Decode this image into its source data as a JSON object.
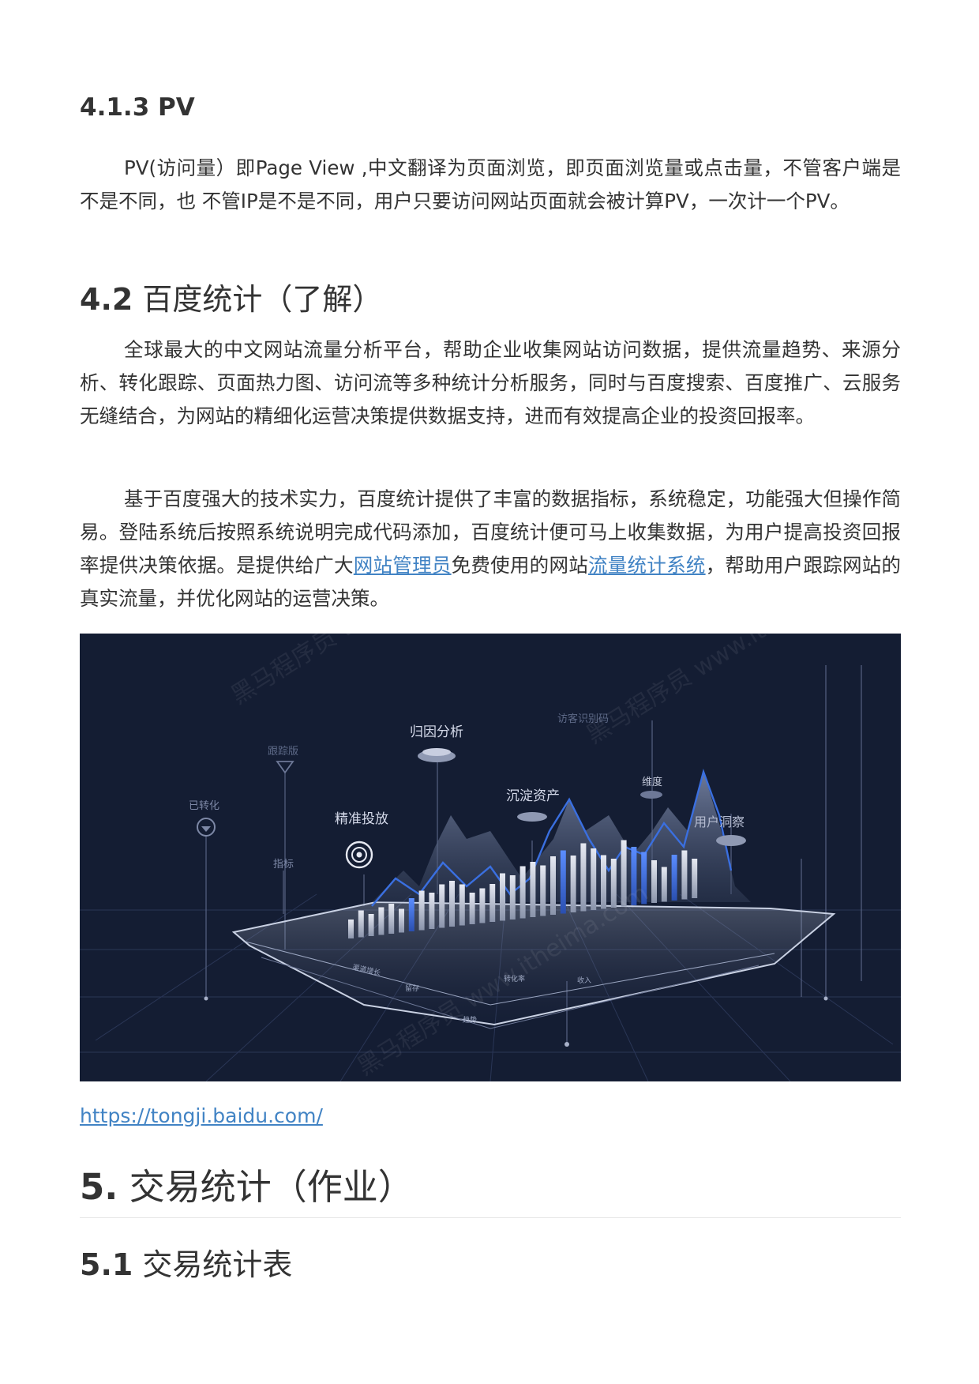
{
  "section_413": {
    "title": "4.1.3 PV"
  },
  "pv_paragraph": {
    "text": "PV(访问量）即Page View ,中文翻译为页面浏览，即页面浏览量或点击量，不管客户端是不是不同，也 不管IP是不是不同，用户只要访问网站页面就会被计算PV，一次计一个PV。"
  },
  "section_42": {
    "number": "4.2",
    "title": "百度统计（了解）"
  },
  "baidu_para1": {
    "text": "全球最大的中文网站流量分析平台，帮助企业收集网站访问数据，提供流量趋势、来源分析、转化跟踪、页面热力图、访问流等多种统计分析服务，同时与百度搜索、百度推广、云服务无缝结合，为网站的精细化运营决策提供数据支持，进而有效提高企业的投资回报率。"
  },
  "baidu_para2": {
    "part1": "基于百度强大的技术实力，百度统计提供了丰富的数据指标，系统稳定，功能强大但操作简易。登陆系统后按照系统说明完成代码添加，百度统计便可马上收集数据，为用户提高投资回报率提供决策依据。是提供给广大",
    "link1": "网站管理员",
    "part2": "免费使用的网站",
    "link2": "流量统计系统",
    "part3": "，帮助用户跟踪网站的真实流量，并优化网站的运营决策。"
  },
  "hero_image": {
    "labels": {
      "attribution": "归因分析",
      "visitor": "访客识别码",
      "tracking": "跟踪版",
      "precise": "精准投放",
      "assets": "沉淀资产",
      "dimension": "维度",
      "converted": "已转化",
      "insight": "用户洞察",
      "metric": "指标",
      "growth": "渠道增长",
      "retain": "留存",
      "trend": "趋势",
      "income": "收入",
      "rate": "转化率"
    },
    "watermark": "黑马程序员 www.itheima.com",
    "colors": {
      "background": "#141d33",
      "accent": "#3a6fe0"
    }
  },
  "url_link": {
    "text": "https://tongji.baidu.com/"
  },
  "section_5": {
    "number": "5.",
    "title": "交易统计（作业）"
  },
  "section_51": {
    "number": "5.1",
    "title": "交易统计表"
  }
}
